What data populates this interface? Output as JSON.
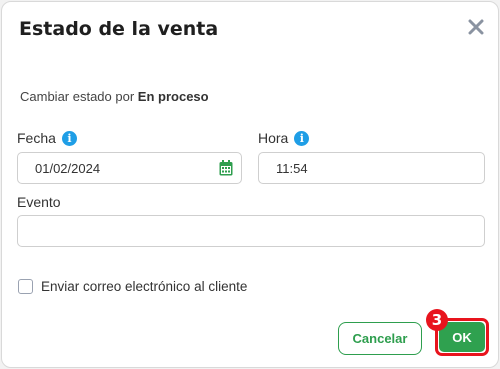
{
  "dialog": {
    "title": "Estado de la venta",
    "close_icon": "close-icon",
    "status_prefix": "Cambiar estado por",
    "status_value": "En proceso"
  },
  "fields": {
    "fecha": {
      "label": "Fecha",
      "value": "01/02/2024",
      "icon": "calendar-icon"
    },
    "hora": {
      "label": "Hora",
      "value": "11:54"
    },
    "evento": {
      "label": "Evento",
      "value": ""
    }
  },
  "info_glyph": "i",
  "checkbox": {
    "label": "Enviar correo electrónico al cliente",
    "checked": false
  },
  "buttons": {
    "cancel": "Cancelar",
    "ok": "OK"
  },
  "annotation": {
    "step": "3"
  },
  "colors": {
    "accent_green": "#2fa14f",
    "info_blue": "#1f9ee6",
    "highlight_red": "#e8141d"
  }
}
